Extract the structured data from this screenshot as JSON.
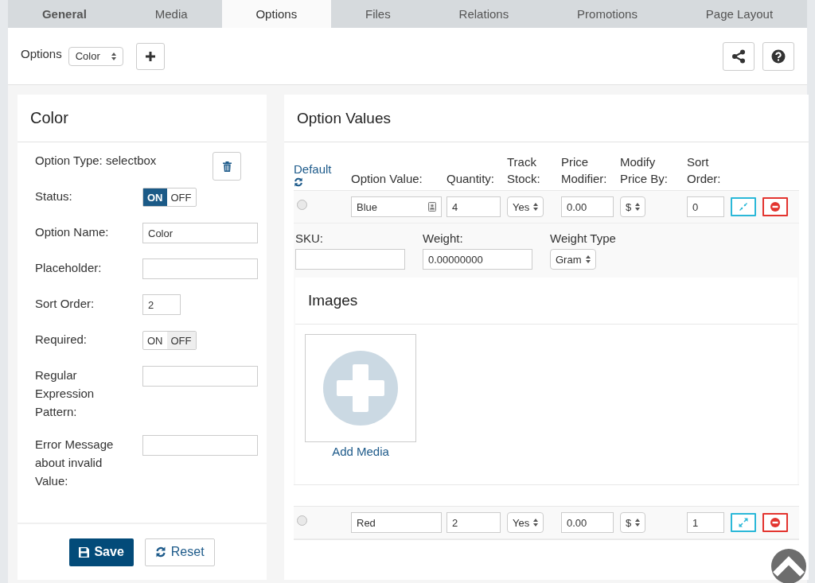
{
  "tabs": [
    {
      "label": "General",
      "selected": false,
      "emphasized": true
    },
    {
      "label": "Media",
      "selected": false,
      "emphasized": false
    },
    {
      "label": "Options",
      "selected": true,
      "emphasized": false
    },
    {
      "label": "Files",
      "selected": false,
      "emphasized": false
    },
    {
      "label": "Relations",
      "selected": false,
      "emphasized": false
    },
    {
      "label": "Promotions",
      "selected": false,
      "emphasized": false
    },
    {
      "label": "Page Layout",
      "selected": false,
      "emphasized": false
    }
  ],
  "toolbar": {
    "label": "Options",
    "select": "Color"
  },
  "option_panel": {
    "title": "Color",
    "type_label": "Option Type: selectbox",
    "fields": [
      {
        "kind": "toggle",
        "label": "Status:",
        "on": true,
        "on_label": "ON",
        "off_label": "OFF"
      },
      {
        "kind": "text",
        "label": "Option Name:",
        "value": "Color"
      },
      {
        "kind": "text",
        "label": "Placeholder:"
      },
      {
        "kind": "short",
        "label": "Sort Order:",
        "value": "2"
      },
      {
        "kind": "toggle",
        "label": "Required:",
        "on": false,
        "on_label": "ON",
        "off_label": "OFF"
      },
      {
        "kind": "text",
        "label": "Regular Expression Pattern:"
      },
      {
        "kind": "text",
        "label": "Error Message about invalid Value:"
      }
    ],
    "save": "Save",
    "reset": "Reset"
  },
  "option_values": {
    "title": "Option Values",
    "default_label": "Default",
    "columns": [
      "Option Value:",
      "Quantity:",
      "Track Stock:",
      "Price Modifier:",
      "Modify Price By:",
      "Sort Order:"
    ],
    "rows": [
      {
        "selected": false,
        "value": "Blue",
        "field_icon": true,
        "quantity": "4",
        "track_stock": "Yes",
        "price": "0.00",
        "modify_by": "$",
        "sort": "0",
        "expanded": true,
        "details": {
          "sku_label": "SKU:",
          "weight_label": "Weight:",
          "weight": "0.00000000",
          "weight_type_label": "Weight Type",
          "weight_type": "Gram",
          "images_title": "Images",
          "add_media": "Add Media"
        }
      },
      {
        "selected": false,
        "value": "Red",
        "field_icon": false,
        "quantity": "2",
        "track_stock": "Yes",
        "price": "0.00",
        "modify_by": "$",
        "sort": "1",
        "expanded": false
      }
    ]
  }
}
